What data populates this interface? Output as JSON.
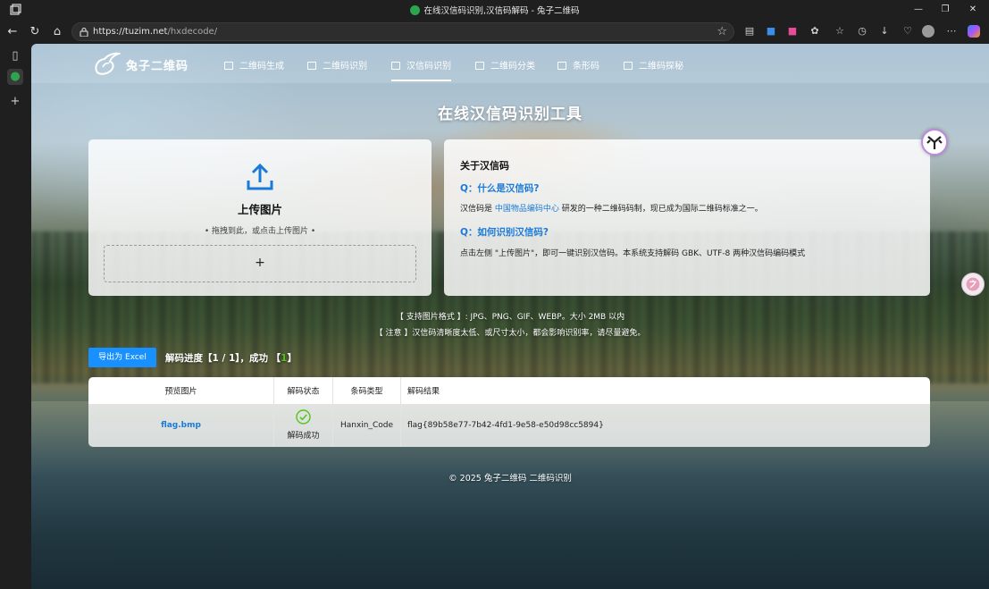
{
  "browser": {
    "window_title": "在线汉信码识别,汉信码解码 - 兔子二维码",
    "url_host": "https://tuzim.net",
    "url_path": "/hxdecode/"
  },
  "site": {
    "logo_text": "兔子二维码",
    "nav": [
      {
        "label": "二维码生成"
      },
      {
        "label": "二维码识别"
      },
      {
        "label": "汉信码识别",
        "active": true
      },
      {
        "label": "二维码分类"
      },
      {
        "label": "条形码"
      },
      {
        "label": "二维码探秘"
      }
    ]
  },
  "page_title": "在线汉信码识别工具",
  "upload": {
    "title": "上传图片",
    "hint": "• 拖拽到此，或点击上传图片 •",
    "plus": "+"
  },
  "about": {
    "title": "关于汉信码",
    "q1": "Q：什么是汉信码?",
    "a1_pre": "汉信码是 ",
    "a1_link": "中国物品编码中心",
    "a1_post": " 研发的一种二维码码制，现已成为国际二维码标准之一。",
    "q2": "Q：如何识别汉信码?",
    "a2": "点击左侧 \"上传图片\"，即可一键识别汉信码。本系统支持解码 GBK、UTF-8 两种汉信码编码模式"
  },
  "notes": {
    "formats": "【 支持图片格式 】:  JPG、PNG、GIF、WEBP。大小 2MB 以内",
    "warning": "【 注意 】汉信码清晰度太低、或尺寸太小，都会影响识别率，请尽量避免。"
  },
  "actions": {
    "export_label": "导出为 Excel",
    "progress_pre": "解码进度【1 / 1】，成功 【",
    "progress_count": "1",
    "progress_post": "】"
  },
  "table": {
    "headers": [
      "预览图片",
      "解码状态",
      "条码类型",
      "解码结果"
    ],
    "rows": [
      {
        "file": "flag.bmp",
        "status": "解码成功",
        "type": "Hanxin_Code",
        "result": "flag{89b58e77-7b42-4fd1-9e58-e50d98cc5894}"
      }
    ]
  },
  "footer": "© 2025 兔子二维码   二维码识别",
  "colors": {
    "accent": "#1890ff",
    "link": "#1a7ad8",
    "success": "#52c41a"
  }
}
